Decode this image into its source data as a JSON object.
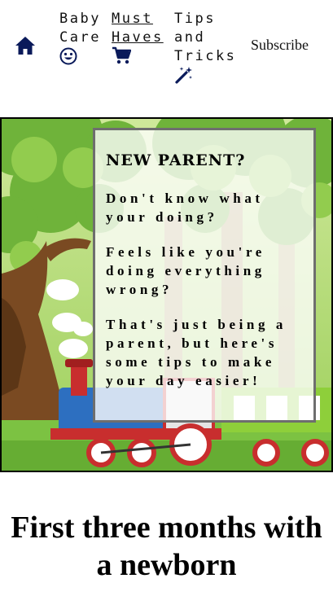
{
  "nav": {
    "home_icon": "home-icon",
    "items": [
      {
        "label": "Baby Care",
        "icon": "smiley-icon"
      },
      {
        "label": "Must Haves",
        "icon": "shopping-cart-icon"
      },
      {
        "label": "Tips and Tricks",
        "icon": "magic-wand-icon"
      }
    ],
    "subscribe": "Subscribe"
  },
  "hero": {
    "title": "NEW PARENT?",
    "paragraphs": [
      "Don't know what your doing?",
      "Feels like you're doing everything wrong?",
      "That's just being a parent, but here's some tips to make your day easier!"
    ]
  },
  "headline": "First three months with a newborn",
  "colors": {
    "icon": "#0a1a5a",
    "card_border": "#6e6e6e"
  }
}
